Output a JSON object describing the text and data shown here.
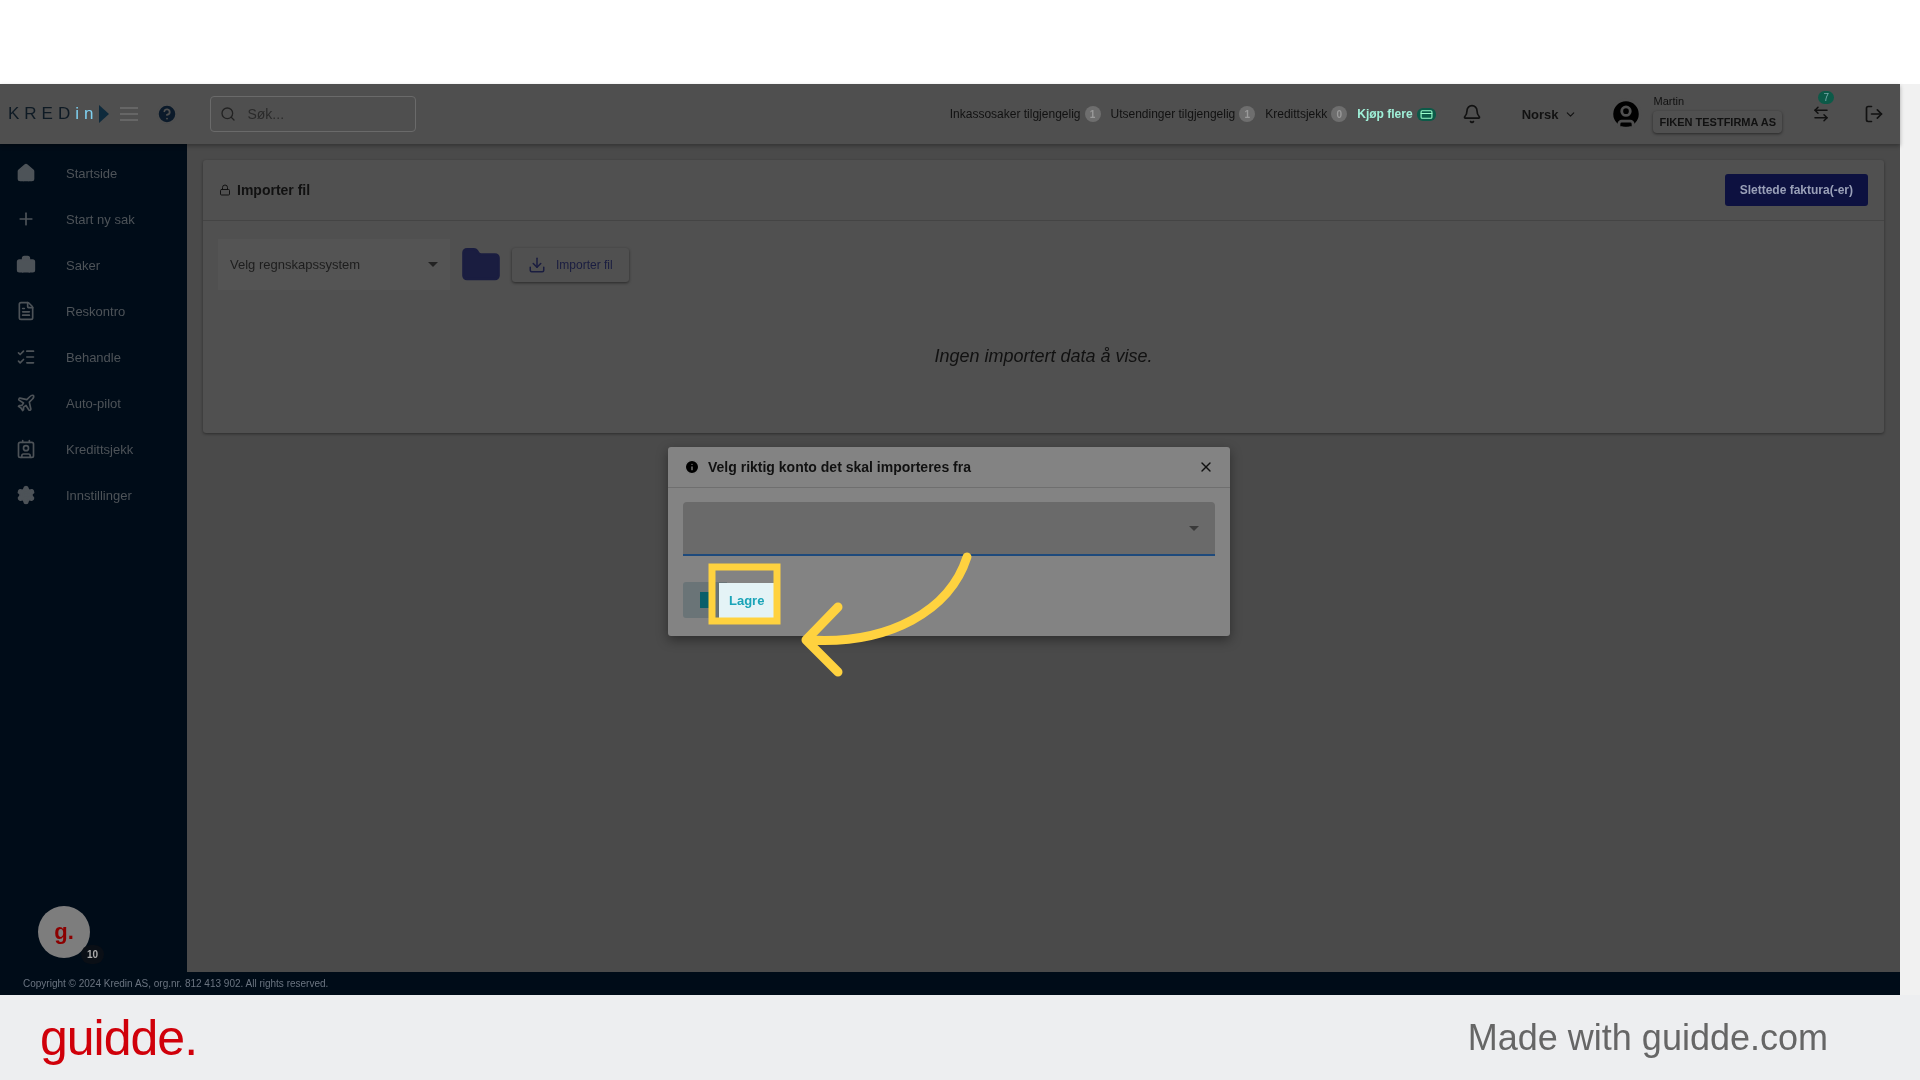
{
  "app_bar": {
    "logo": {
      "main": "KRED",
      "accent": "in"
    },
    "search": {
      "placeholder": "Søk..."
    },
    "counters": [
      {
        "label": "Inkassosaker tilgjengelig",
        "count": "1"
      },
      {
        "label": "Utsendinger tilgjengelig",
        "count": "1"
      },
      {
        "label": "Kredittsjekk",
        "count": "0"
      }
    ],
    "buy_more": "Kjøp flere",
    "language": "Norsk",
    "user": {
      "name": "Martin",
      "company": "FIKEN TESTFIRMA AS"
    },
    "switch_badge": "7"
  },
  "sidebar": {
    "items": [
      {
        "label": "Startside"
      },
      {
        "label": "Start ny sak"
      },
      {
        "label": "Saker"
      },
      {
        "label": "Reskontro"
      },
      {
        "label": "Behandle"
      },
      {
        "label": "Auto-pilot"
      },
      {
        "label": "Kredittsjekk"
      },
      {
        "label": "Innstillinger"
      }
    ],
    "avatar": {
      "letter": "g.",
      "badge": "10"
    }
  },
  "card": {
    "title": "Importer fil",
    "deleted_button": "Slettede faktura(-er)",
    "system_select": {
      "placeholder": "Velg regnskapssystem"
    },
    "import_button": "Importer fil",
    "empty_message": "Ingen importert data å vise."
  },
  "dialog": {
    "title": "Velg riktig konto det skal importeres fra",
    "save_button": "Lagre"
  },
  "footer": {
    "copyright": "Copyright © 2024 Kredin AS, org.nr. 812 413 902. All rights reserved."
  },
  "branding": {
    "logo": "guidde.",
    "made_with": "Made with guidde.com"
  }
}
